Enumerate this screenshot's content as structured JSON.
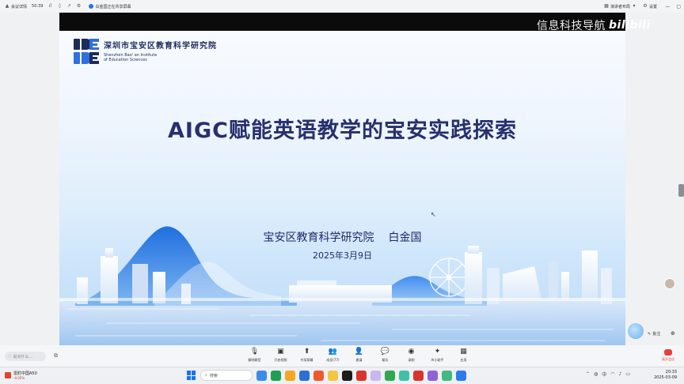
{
  "meeting_bar": {
    "details_label": "会议详情",
    "timer": "50:39",
    "share_title": "白金国正在共享屏幕",
    "speaker_label": "演讲者布局",
    "settings_label": "设置"
  },
  "watermark": {
    "text": "信息科技导航",
    "brand": "bilibili"
  },
  "slide": {
    "logo_cn": "深圳市宝安区教育科学研究院",
    "logo_en_1": "Shenzhen Bao' an Institute",
    "logo_en_2": "of Education Sciences",
    "title": "AIGC赋能英语教学的宝安实践探索",
    "presenter_org": "宝安区教育科学研究院",
    "presenter_name": "白金国",
    "date": "2025年3月9日"
  },
  "side": {
    "annotate_label": "批注"
  },
  "chat": {
    "placeholder": "说点什么..."
  },
  "toolbar": {
    "items": [
      {
        "label": "解除静音",
        "icon": "mic-muted-icon"
      },
      {
        "label": "开启视频",
        "icon": "camera-icon"
      },
      {
        "label": "共享屏幕",
        "icon": "share-screen-icon"
      },
      {
        "label": "成员(77)",
        "icon": "members-icon"
      },
      {
        "label": "邀请",
        "icon": "invite-icon"
      },
      {
        "label": "聊天",
        "icon": "chat-icon"
      },
      {
        "label": "录制",
        "icon": "record-icon"
      },
      {
        "label": "AI小助手",
        "icon": "ai-assistant-icon"
      },
      {
        "label": "应用",
        "icon": "apps-icon"
      }
    ],
    "end_label": "离开会议"
  },
  "taskbar": {
    "weather_title": "雷肘中国A50",
    "weather_change": "-0.05%",
    "search_label": "搜索",
    "time": "20:33",
    "date": "2025-03-09"
  },
  "colors": {
    "title": "#27306d",
    "accent": "#2f6fe0",
    "end_red": "#e5413a"
  }
}
